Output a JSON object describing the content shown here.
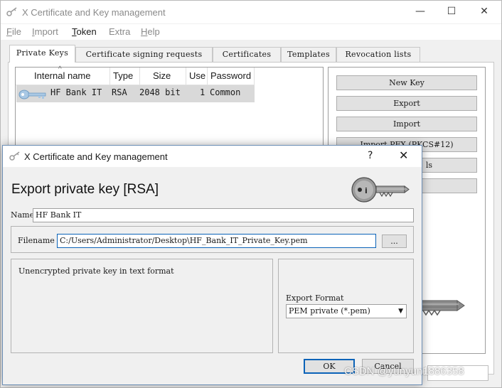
{
  "app": {
    "title": "X Certificate and Key management",
    "controls": {
      "minimize": "—",
      "maximize": "☐",
      "close": "✕"
    }
  },
  "menu": [
    {
      "label": "File",
      "mnemonic": "F",
      "rest": "ile"
    },
    {
      "label": "Import",
      "mnemonic": "I",
      "rest": "mport"
    },
    {
      "label": "Token",
      "mnemonic": "T",
      "rest": "oken"
    },
    {
      "label": "Extra",
      "mnemonic": "",
      "rest": "Extra"
    },
    {
      "label": "Help",
      "mnemonic": "H",
      "rest": "elp"
    }
  ],
  "tabs": [
    {
      "label": "Private Keys",
      "active": true
    },
    {
      "label": "Certificate signing requests",
      "active": false
    },
    {
      "label": "Certificates",
      "active": false
    },
    {
      "label": "Templates",
      "active": false
    },
    {
      "label": "Revocation lists",
      "active": false
    }
  ],
  "key_table": {
    "columns": [
      "Internal name",
      "Type",
      "Size",
      "Use",
      "Password"
    ],
    "sort_indicator": "^",
    "rows": [
      {
        "name": "HF Bank IT",
        "type": "RSA",
        "size": "2048 bit",
        "use": "1",
        "password": "Common"
      }
    ]
  },
  "side_buttons": {
    "new_key": "New Key",
    "export": "Export",
    "import": "Import",
    "import_pfx": "Import PFX (PKCS#12)",
    "show_details": "ls"
  },
  "dialog": {
    "title": "X Certificate and Key management",
    "help": "?",
    "close": "✕",
    "heading": "Export private key [RSA]",
    "name_label": "Name",
    "name_value": "HF Bank IT",
    "filename_label": "Filename",
    "filename_value": "C:/Users/Administrator/Desktop\\HF_Bank_IT_Private_Key.pem",
    "browse_label": "...",
    "description": "Unencrypted private key in text format",
    "export_format_label": "Export Format",
    "export_format_value": "PEM private (*.pem)",
    "ok_label": "OK",
    "cancel_label": "Cancel"
  },
  "watermark": "CSDN @yunyun1886358",
  "colors": {
    "focus": "#0b63b8",
    "selected_row": "#d9d9d9"
  }
}
